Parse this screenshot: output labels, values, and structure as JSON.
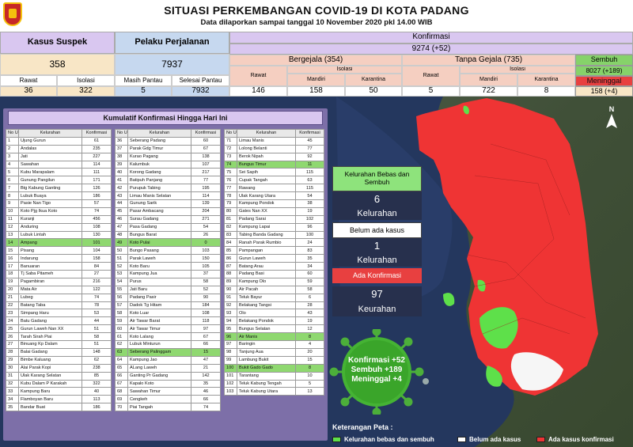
{
  "header": {
    "title": "SITUASI PERKEMBANGAN COVID-19 DI KOTA PADANG",
    "subtitle": "Data dilaporkan sampai tanggal 10 November 2020 pkl 14.00 WIB"
  },
  "summary": {
    "suspek": {
      "label": "Kasus Suspek",
      "value": "358",
      "rawat_label": "Rawat",
      "rawat": "36",
      "isolasi_label": "Isolasi",
      "isolasi": "322"
    },
    "perjalanan": {
      "label": "Pelaku Perjalanan",
      "value": "7937",
      "pantau_label": "Masih Pantau",
      "pantau": "5",
      "selesai_label": "Selesai Pantau",
      "selesai": "7932"
    },
    "konfirmasi": {
      "label": "Konfirmasi",
      "value": "9274 (+52)"
    },
    "bergejala": {
      "label": "Bergejala (354)",
      "rawat_label": "Rawat",
      "rawat": "146",
      "isolasi_label": "Isolasi",
      "mandiri_label": "Mandiri",
      "mandiri": "158",
      "karantina_label": "Karantina",
      "karantina": "50"
    },
    "tanpa_gejala": {
      "label": "Tanpa Gejala (735)",
      "rawat_label": "Rawat",
      "rawat": "5",
      "isolasi_label": "Isolasi",
      "mandiri_label": "Mandiri",
      "mandiri": "722",
      "karantina_label": "Karantina",
      "karantina": "8"
    },
    "sembuh": {
      "label": "Sembuh",
      "value": "8027 (+189)"
    },
    "meninggal": {
      "label": "Meninggal",
      "value": "158 (+4)"
    }
  },
  "table": {
    "title": "Kumulatif Konfirmasi Hingga Hari Ini",
    "h_no": "No Urut",
    "h_kel": "Kelurahan",
    "h_val": "Konfirmasi",
    "rows": [
      [
        "1",
        "Ujung Gurun",
        "61"
      ],
      [
        "2",
        "Andalas",
        "235"
      ],
      [
        "3",
        "Jati",
        "227"
      ],
      [
        "4",
        "Sawahan",
        "114"
      ],
      [
        "5",
        "Kubu Marapalam",
        "111"
      ],
      [
        "6",
        "Gunung Pangilun",
        "171"
      ],
      [
        "7",
        "Btg Kabung Ganting",
        "126"
      ],
      [
        "8",
        "Lubuk Buaya",
        "186"
      ],
      [
        "9",
        "Pasie Nan Tigo",
        "57"
      ],
      [
        "10",
        "Koto Pjg Ikua Koto",
        "74"
      ],
      [
        "11",
        "Kuranji",
        "456"
      ],
      [
        "12",
        "Anduring",
        "108"
      ],
      [
        "13",
        "Lubuk Lintah",
        "130"
      ],
      [
        "14",
        "Ampang",
        "101"
      ],
      [
        "15",
        "Pisang",
        "104"
      ],
      [
        "16",
        "Indarung",
        "158"
      ],
      [
        "17",
        "Banuaran",
        "84"
      ],
      [
        "18",
        "Tj Saba Pitameh",
        "27"
      ],
      [
        "19",
        "Pagambiran",
        "216"
      ],
      [
        "20",
        "Mata Air",
        "122"
      ],
      [
        "21",
        "Lubeg",
        "74"
      ],
      [
        "22",
        "Batang Taba",
        "78"
      ],
      [
        "23",
        "Simpang Haru",
        "53"
      ],
      [
        "24",
        "Batu Gadang",
        "44"
      ],
      [
        "25",
        "Gurun Laweh Nan XX",
        "51"
      ],
      [
        "26",
        "Tarah Sirah Piai",
        "58"
      ],
      [
        "27",
        "Binuang Kp Dalam",
        "51"
      ],
      [
        "28",
        "Balai Gadang",
        "148"
      ],
      [
        "29",
        "Bimbe Kaluang",
        "62"
      ],
      [
        "30",
        "Alai Parak Kopi",
        "238"
      ],
      [
        "31",
        "Ulak Karang Selatan",
        "85"
      ],
      [
        "32",
        "Kubu Dalam P Karakah",
        "322"
      ],
      [
        "33",
        "Kampung Baru",
        "40"
      ],
      [
        "34",
        "Flamboyan Baru",
        "113"
      ],
      [
        "35",
        "Bandar Buat",
        "186"
      ],
      [
        "36",
        "Seberang Padang",
        "60"
      ],
      [
        "37",
        "Parak Gdg Timur",
        "67"
      ],
      [
        "38",
        "Kurao Pagang",
        "138"
      ],
      [
        "39",
        "Kalumbuk",
        "107"
      ],
      [
        "40",
        "Korong Gadang",
        "217"
      ],
      [
        "41",
        "Batipuh Panjang",
        "77"
      ],
      [
        "42",
        "Purupuk Tabing",
        "195"
      ],
      [
        "43",
        "Limau Manis Selatan",
        "114"
      ],
      [
        "44",
        "Gunung Sarik",
        "139"
      ],
      [
        "45",
        "Pasar Ambacang",
        "204"
      ],
      [
        "46",
        "Surau Gadang",
        "271"
      ],
      [
        "47",
        "Pasa Gadang",
        "54"
      ],
      [
        "48",
        "Bungus Barat",
        "26"
      ],
      [
        "49",
        "Koto Pulai",
        "0"
      ],
      [
        "50",
        "Bungo Pasang",
        "103"
      ],
      [
        "51",
        "Parak Laweh",
        "150"
      ],
      [
        "52",
        "Koto Baru",
        "105"
      ],
      [
        "53",
        "Kampung Jua",
        "37"
      ],
      [
        "54",
        "Purus",
        "58"
      ],
      [
        "55",
        "Jati Baru",
        "52"
      ],
      [
        "56",
        "Padang Pasir",
        "90"
      ],
      [
        "57",
        "Dadok Tg Hitam",
        "184"
      ],
      [
        "58",
        "Koto Luar",
        "108"
      ],
      [
        "59",
        "Air Tawar Barat",
        "118"
      ],
      [
        "60",
        "Air Tawar Timur",
        "97"
      ],
      [
        "61",
        "Koto Lalang",
        "67"
      ],
      [
        "62",
        "Lubuk Minturun",
        "66"
      ],
      [
        "63",
        "Seberang Palinggam",
        "15"
      ],
      [
        "64",
        "Kampung Jao",
        "47"
      ],
      [
        "65",
        "ALang Laweh",
        "21"
      ],
      [
        "66",
        "Ganting Pr Gadang",
        "142"
      ],
      [
        "67",
        "Kapalo Koto",
        "35"
      ],
      [
        "68",
        "Sawahan Timur",
        "46"
      ],
      [
        "69",
        "Cengkeh",
        "66"
      ],
      [
        "70",
        "Piai Tangah",
        "74"
      ],
      [
        "71",
        "Limau Manis",
        "45"
      ],
      [
        "72",
        "Lolong Belanti",
        "77"
      ],
      [
        "73",
        "Berok Nipah",
        "92"
      ],
      [
        "74",
        "Bungus Timur",
        "11"
      ],
      [
        "75",
        "Sei Sapih",
        "115"
      ],
      [
        "76",
        "Cupak Tangah",
        "63"
      ],
      [
        "77",
        "Rawang",
        "115"
      ],
      [
        "78",
        "Ulak Karang Utara",
        "54"
      ],
      [
        "79",
        "Kampung Pondok",
        "38"
      ],
      [
        "80",
        "Gates Nan XX",
        "19"
      ],
      [
        "81",
        "Padang Sarai",
        "102"
      ],
      [
        "82",
        "Kampung Lapai",
        "96"
      ],
      [
        "83",
        "Tabing Banda Gadang",
        "100"
      ],
      [
        "84",
        "Ranah Parak Rumbio",
        "24"
      ],
      [
        "85",
        "Pampangan",
        "83"
      ],
      [
        "86",
        "Gurun Laweh",
        "35"
      ],
      [
        "87",
        "Batang Arau",
        "34"
      ],
      [
        "88",
        "Padang Basi",
        "60"
      ],
      [
        "89",
        "Kampung Olo",
        "59"
      ],
      [
        "90",
        "Air Pacah",
        "58"
      ],
      [
        "91",
        "Teluk Bayur",
        "6"
      ],
      [
        "92",
        "Belakang Tangsi",
        "28"
      ],
      [
        "93",
        "Olo",
        "43"
      ],
      [
        "94",
        "Belakang Pondok",
        "19"
      ],
      [
        "95",
        "Bungus Selatan",
        "12"
      ],
      [
        "96",
        "Air Manis",
        "8"
      ],
      [
        "97",
        "Baringin",
        "4"
      ],
      [
        "98",
        "Tanjung Aua",
        "20"
      ],
      [
        "99",
        "Lambung Bukit",
        "15"
      ],
      [
        "100",
        "Bukit Gado Gado",
        "8"
      ],
      [
        "101",
        "Tarantang",
        "10"
      ],
      [
        "102",
        "Teluk Kabung Tengah",
        "5"
      ],
      [
        "103",
        "Teluk Kabung Utara",
        "13"
      ]
    ],
    "green": [
      "14",
      "49",
      "63",
      "74",
      "96",
      "100"
    ]
  },
  "side": {
    "bebas_label": "Kelurahan Bebas dan Sembuh",
    "bebas_count": "6",
    "bebas_unit": "Kelurahan",
    "belum_label": "Belum ada kasus",
    "belum_count": "1",
    "belum_unit": "Kelurahan",
    "ada_label": "Ada Konfirmasi",
    "ada_count": "97",
    "ada_unit": "Keurahan"
  },
  "badge": {
    "line1": "Konfirmasi +52",
    "line2": "Sembuh +189",
    "line3": "Meninggal +4"
  },
  "legend": {
    "title": "Keterangan Peta :",
    "green": "Kelurahan bebas dan sembuh",
    "white": "Belum ada kasus",
    "red": "Ada kasus konfirmasi"
  },
  "colors": {
    "purple": "#d9c7f0",
    "orange": "#f8e6c6",
    "pink": "#f5cfc1",
    "blue": "#c6d8ef",
    "green": "#86d26a",
    "red": "#e84040",
    "panel": "#7d6fa8"
  }
}
